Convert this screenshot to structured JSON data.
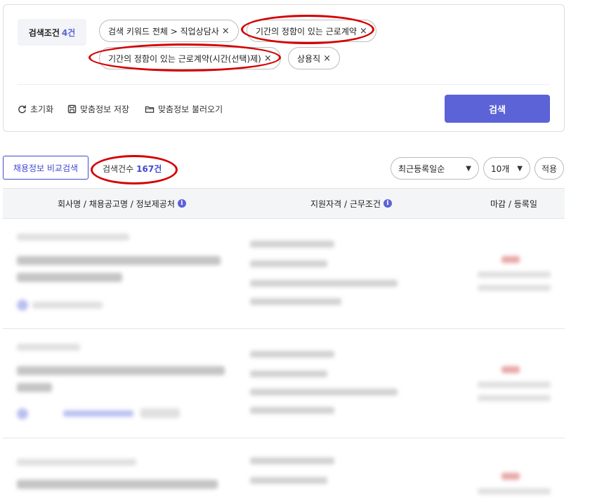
{
  "filter": {
    "label": "검색조건",
    "count": "4건",
    "chips": [
      {
        "label": "검색 키워드 전체 > 직업상담사",
        "remove": "×"
      },
      {
        "label": "기간의 정함이 있는 근로계약",
        "remove": "×"
      },
      {
        "label": "기간의 정함이 있는 근로계약(시간(선택)제)",
        "remove": "×"
      },
      {
        "label": "상용직",
        "remove": "×"
      }
    ],
    "reset_label": "초기화",
    "save_label": "맞춤정보 저장",
    "load_label": "맞춤정보 불러오기",
    "search_label": "검색"
  },
  "results": {
    "compare_label": "채용정보 비교검색",
    "count_prefix": "검색건수",
    "count_value": "167건",
    "sort_selected": "최근등록일순",
    "page_size_selected": "10개",
    "apply_label": "적용"
  },
  "table": {
    "headers": [
      {
        "label": "회사명 / 채용공고명 / 정보제공처",
        "info": "i"
      },
      {
        "label": "지원자격 / 근무조건",
        "info": "i"
      },
      {
        "label": "마감 / 등록일"
      }
    ]
  },
  "icons": [
    "reset-icon",
    "save-icon",
    "folder-icon",
    "close-icon",
    "chevron-down-icon",
    "info-icon"
  ],
  "colors": {
    "accent": "#5b63d6",
    "highlight": "#d40000"
  }
}
